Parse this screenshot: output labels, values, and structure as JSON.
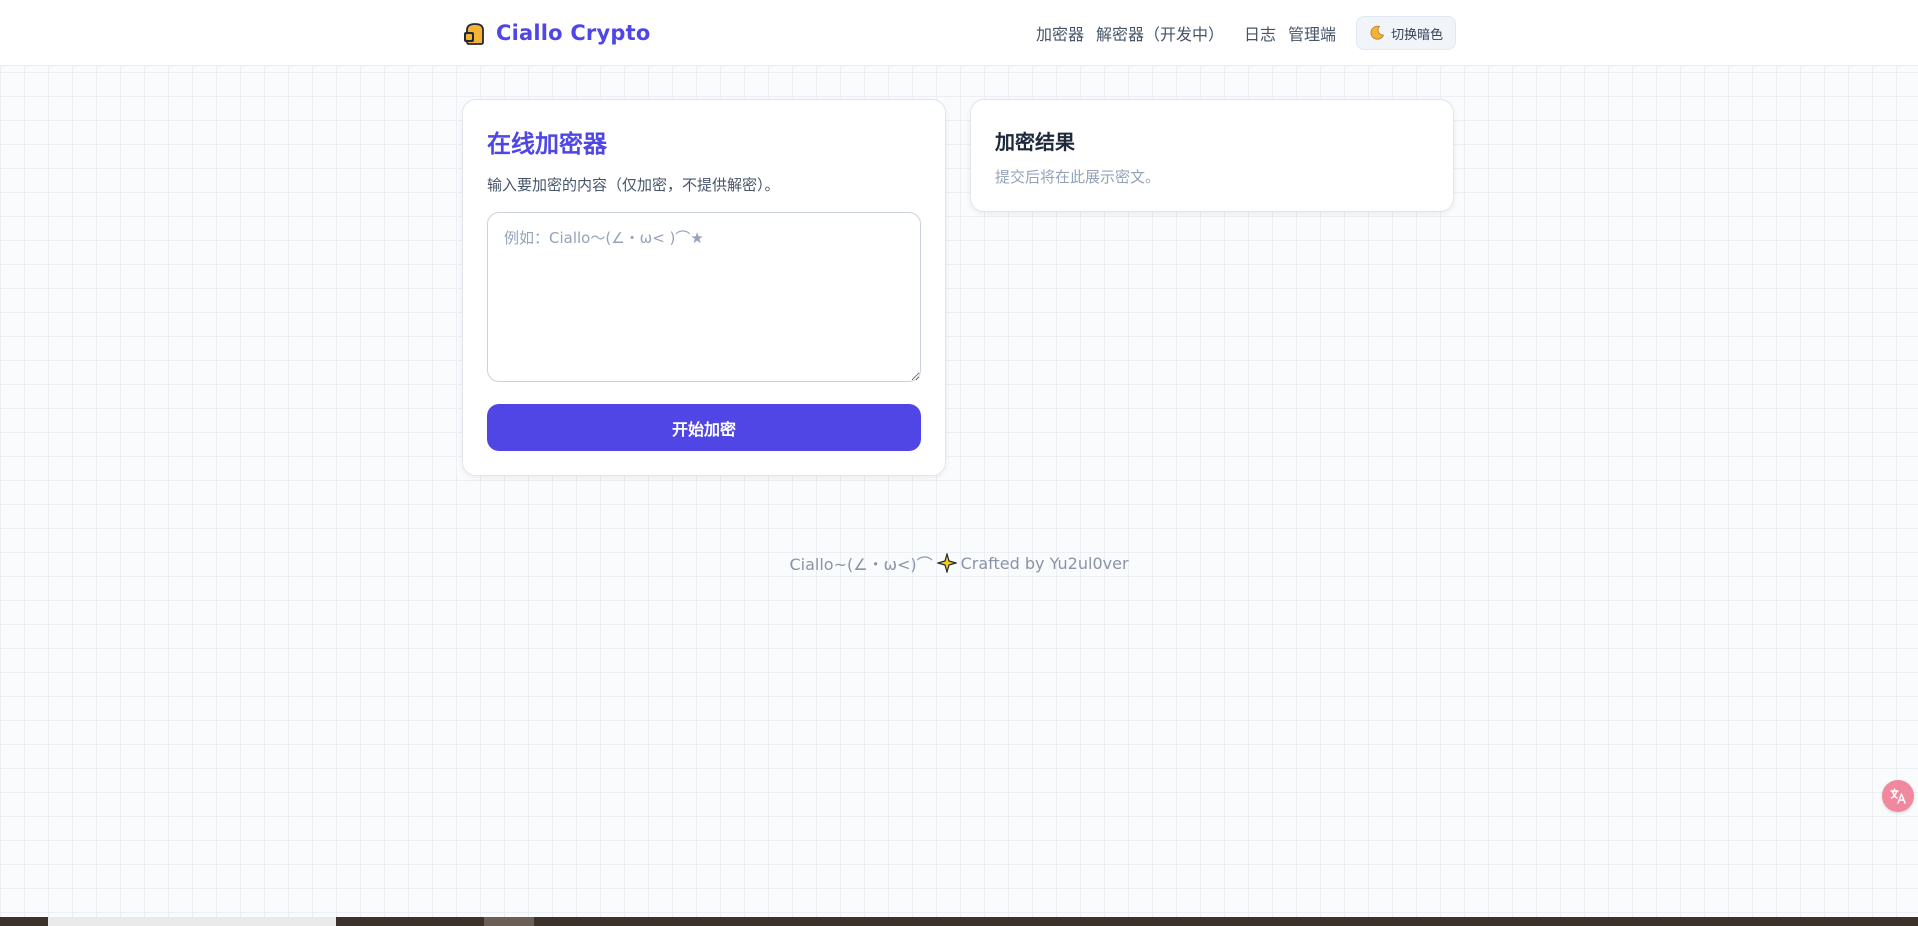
{
  "header": {
    "brand": "Ciallo Crypto",
    "brand_icon": "toast-icon",
    "nav": [
      {
        "label": "加密器"
      },
      {
        "label": "解密器（开发中）"
      },
      {
        "label": "日志"
      },
      {
        "label": "管理端"
      }
    ],
    "theme_toggle": {
      "label": "切换暗色",
      "icon": "moon-icon"
    }
  },
  "encrypt_card": {
    "title": "在线加密器",
    "description": "输入要加密的内容（仅加密，不提供解密）。",
    "input_placeholder": "例如：Ciallo～(∠・ω< )⌒★",
    "input_value": "",
    "submit_label": "开始加密"
  },
  "result_card": {
    "title": "加密结果",
    "placeholder_text": "提交后将在此展示密文。"
  },
  "footer": {
    "prefix": "Ciallo~(∠・ω<)⌒",
    "suffix": "Crafted by Yu2ul0ver",
    "icon": "sparkle-icon"
  },
  "floating_button": {
    "icon": "translate-icon"
  },
  "colors": {
    "accent": "#4f46e5",
    "background": "#fafbfd",
    "grid_line": "#eceff3",
    "float_button": "#f0899e"
  }
}
